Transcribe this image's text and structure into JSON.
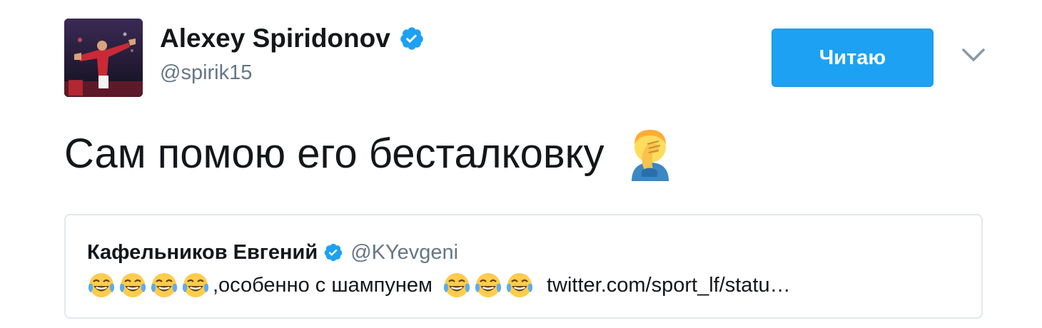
{
  "tweet": {
    "author": {
      "name": "Alexey Spiridonov",
      "handle": "@spirik15",
      "avatar_icon": "athlete-photo-avatar",
      "verified": true
    },
    "follow_button_label": "Читаю",
    "menu_icon": "chevron-down-icon",
    "text": "Сам помою его бесталковку",
    "text_emoji": "facepalm-emoji",
    "quote": {
      "name": "Кафельников Евгений",
      "handle": "@KYevgeni",
      "verified": true,
      "text_segments": [
        {
          "type": "emoji",
          "icon": "tears-of-joy-emoji",
          "count": 4
        },
        {
          "type": "text",
          "value": ",особенно с шампунем"
        },
        {
          "type": "emoji",
          "icon": "tears-of-joy-emoji",
          "count": 3
        },
        {
          "type": "link",
          "value": "twitter.com/sport_lf/statu…"
        }
      ],
      "body_text": ",особенно с шампунем",
      "link_text": "twitter.com/sport_lf/statu…"
    },
    "colors": {
      "accent": "#1da1f2",
      "text": "#14171a",
      "muted": "#657786",
      "border": "#e1e8ed"
    }
  }
}
